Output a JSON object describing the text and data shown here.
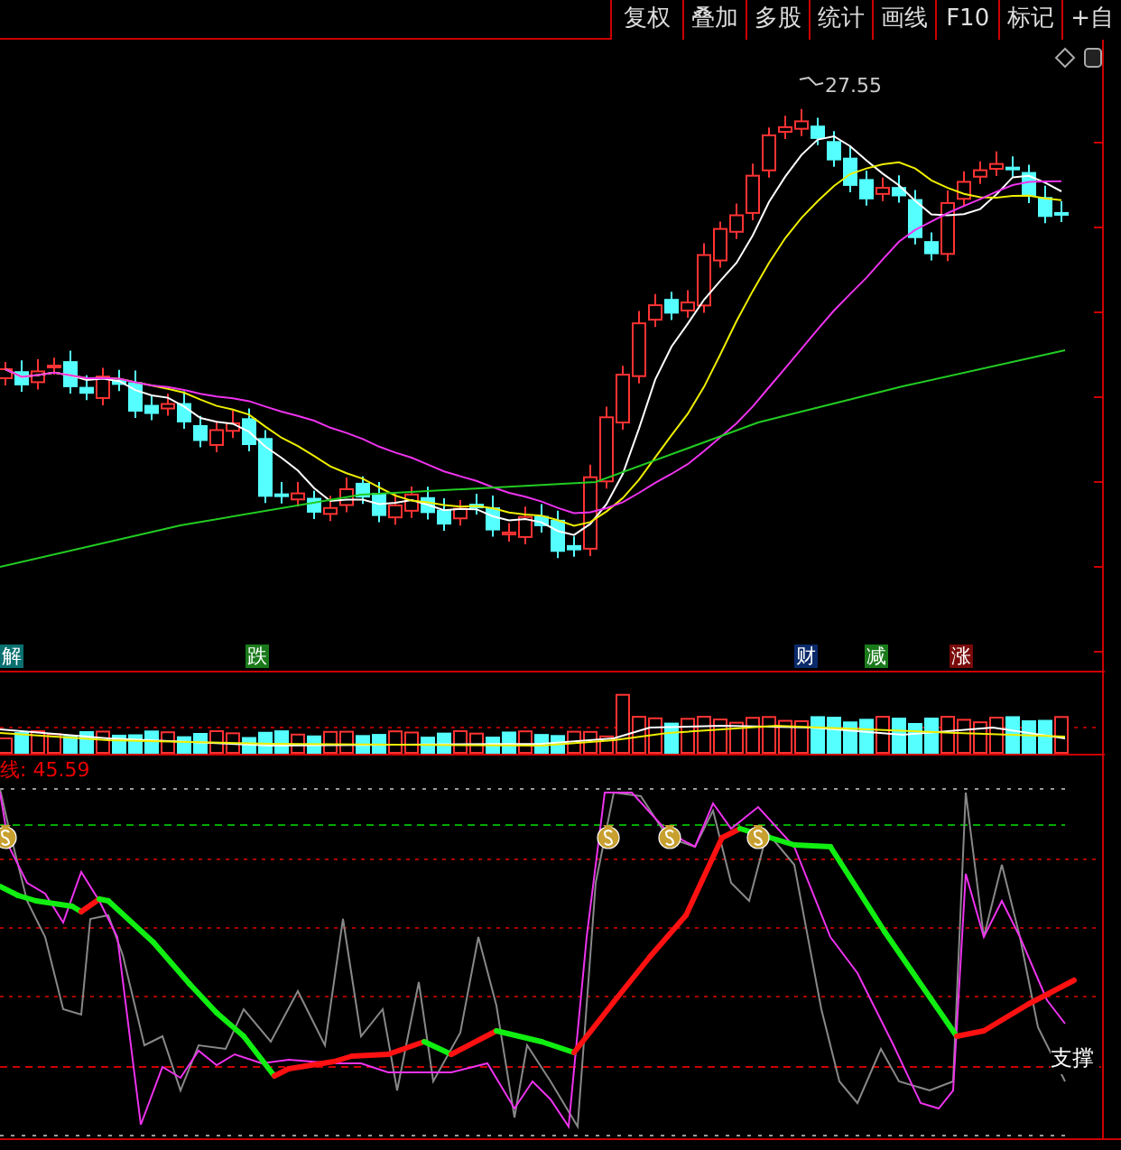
{
  "toolbar": {
    "buttons": [
      "复权",
      "叠加",
      "多股",
      "统计",
      "画线",
      "F10",
      "标记",
      "+自"
    ]
  },
  "price_chart": {
    "high_label": "27.55"
  },
  "event_markers": [
    {
      "label": "解",
      "color": "#0a7070"
    },
    {
      "label": "跌",
      "color": "#1a7a1a"
    },
    {
      "label": "财",
      "color": "#0a2a6a"
    },
    {
      "label": "减",
      "color": "#1a7a1a"
    },
    {
      "label": "涨",
      "color": "#7a0a0a"
    }
  ],
  "indicator": {
    "label": "线: 45.59",
    "signal_label": "支撑"
  }
}
